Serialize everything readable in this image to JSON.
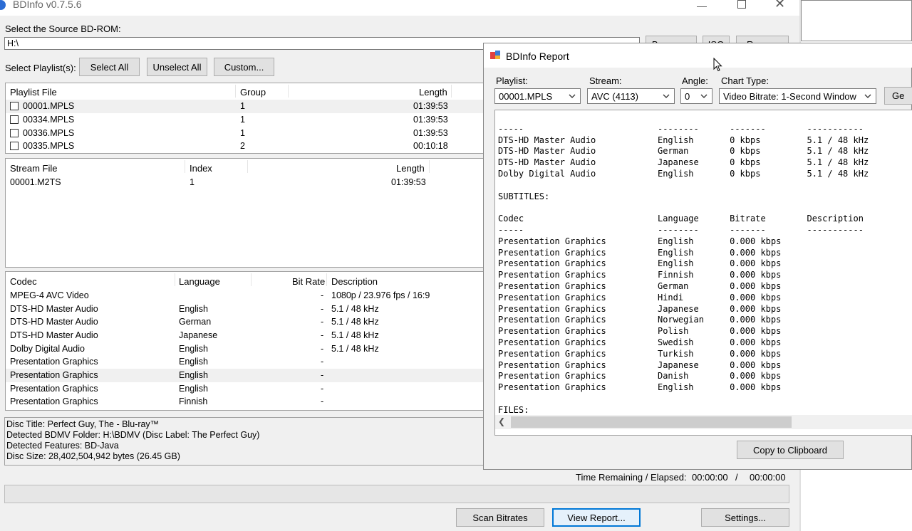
{
  "window": {
    "title": "BDInfo v0.7.5.6"
  },
  "source": {
    "label": "Select the Source BD-ROM:",
    "value": "H:\\",
    "browse_label": "Browse...",
    "iso_label": "ISO",
    "rescan_label": "Rescan"
  },
  "playlist_toolbar": {
    "label": "Select Playlist(s):",
    "select_all": "Select All",
    "unselect_all": "Unselect All",
    "custom": "Custom..."
  },
  "playlists": {
    "headers": [
      "Playlist File",
      "Group",
      "Length"
    ],
    "rows": [
      {
        "file": "00001.MPLS",
        "group": "1",
        "length": "01:39:53"
      },
      {
        "file": "00334.MPLS",
        "group": "1",
        "length": "01:39:53"
      },
      {
        "file": "00336.MPLS",
        "group": "1",
        "length": "01:39:53"
      },
      {
        "file": "00335.MPLS",
        "group": "2",
        "length": "00:10:18"
      }
    ]
  },
  "streams": {
    "headers": [
      "Stream File",
      "Index",
      "Length"
    ],
    "rows": [
      {
        "file": "00001.M2TS",
        "index": "1",
        "length": "01:39:53"
      }
    ]
  },
  "codecs": {
    "headers": [
      "Codec",
      "Language",
      "Bit Rate",
      "Description"
    ],
    "rows": [
      {
        "codec": "MPEG-4 AVC Video",
        "lang": "",
        "rate": "-",
        "desc": "1080p / 23.976 fps / 16:9"
      },
      {
        "codec": "DTS-HD Master Audio",
        "lang": "English",
        "rate": "-",
        "desc": "5.1 / 48 kHz"
      },
      {
        "codec": "DTS-HD Master Audio",
        "lang": "German",
        "rate": "-",
        "desc": "5.1 / 48 kHz"
      },
      {
        "codec": "DTS-HD Master Audio",
        "lang": "Japanese",
        "rate": "-",
        "desc": "5.1 / 48 kHz"
      },
      {
        "codec": "Dolby Digital Audio",
        "lang": "English",
        "rate": "-",
        "desc": "5.1 / 48 kHz"
      },
      {
        "codec": "Presentation Graphics",
        "lang": "English",
        "rate": "-",
        "desc": ""
      },
      {
        "codec": "Presentation Graphics",
        "lang": "English",
        "rate": "-",
        "desc": ""
      },
      {
        "codec": "Presentation Graphics",
        "lang": "English",
        "rate": "-",
        "desc": ""
      },
      {
        "codec": "Presentation Graphics",
        "lang": "Finnish",
        "rate": "-",
        "desc": ""
      }
    ]
  },
  "disc_info": [
    "Disc Title: Perfect Guy, The - Blu-ray™",
    "Detected BDMV Folder: H:\\BDMV (Disc Label: The Perfect Guy)",
    "Detected Features: BD-Java",
    "Disc Size: 28,402,504,942 bytes (26.45 GB)"
  ],
  "status": {
    "time_label": "Time Remaining / Elapsed:",
    "remaining": "00:00:00",
    "separator": "/",
    "elapsed": "00:00:00"
  },
  "bottom_buttons": {
    "scan": "Scan Bitrates",
    "view": "View Report...",
    "settings": "Settings..."
  },
  "report": {
    "title": "BDInfo Report",
    "playlist_label": "Playlist:",
    "playlist_value": "00001.MPLS",
    "stream_label": "Stream:",
    "stream_value": "AVC (4113)",
    "angle_label": "Angle:",
    "angle_value": "0",
    "chart_label": "Chart Type:",
    "chart_value": "Video Bitrate: 1-Second Window",
    "generate_label": "Ge",
    "copy_label": "Copy to Clipboard",
    "lines": [
      "-----                          --------      -------        -----------",
      "DTS-HD Master Audio            English       0 kbps         5.1 / 48 kHz",
      "DTS-HD Master Audio            German        0 kbps         5.1 / 48 kHz",
      "DTS-HD Master Audio            Japanese      0 kbps         5.1 / 48 kHz",
      "Dolby Digital Audio            English       0 kbps         5.1 / 48 kHz",
      "",
      "SUBTITLES:",
      "",
      "Codec                          Language      Bitrate        Description",
      "-----                          --------      -------        -----------",
      "Presentation Graphics          English       0.000 kbps",
      "Presentation Graphics          English       0.000 kbps",
      "Presentation Graphics          English       0.000 kbps",
      "Presentation Graphics          Finnish       0.000 kbps",
      "Presentation Graphics          German        0.000 kbps",
      "Presentation Graphics          Hindi         0.000 kbps",
      "Presentation Graphics          Japanese      0.000 kbps",
      "Presentation Graphics          Norwegian     0.000 kbps",
      "Presentation Graphics          Polish        0.000 kbps",
      "Presentation Graphics          Swedish       0.000 kbps",
      "Presentation Graphics          Turkish       0.000 kbps",
      "Presentation Graphics          Japanese      0.000 kbps",
      "Presentation Graphics          Danish        0.000 kbps",
      "Presentation Graphics          English       0.000 kbps",
      "",
      "FILES:"
    ]
  }
}
